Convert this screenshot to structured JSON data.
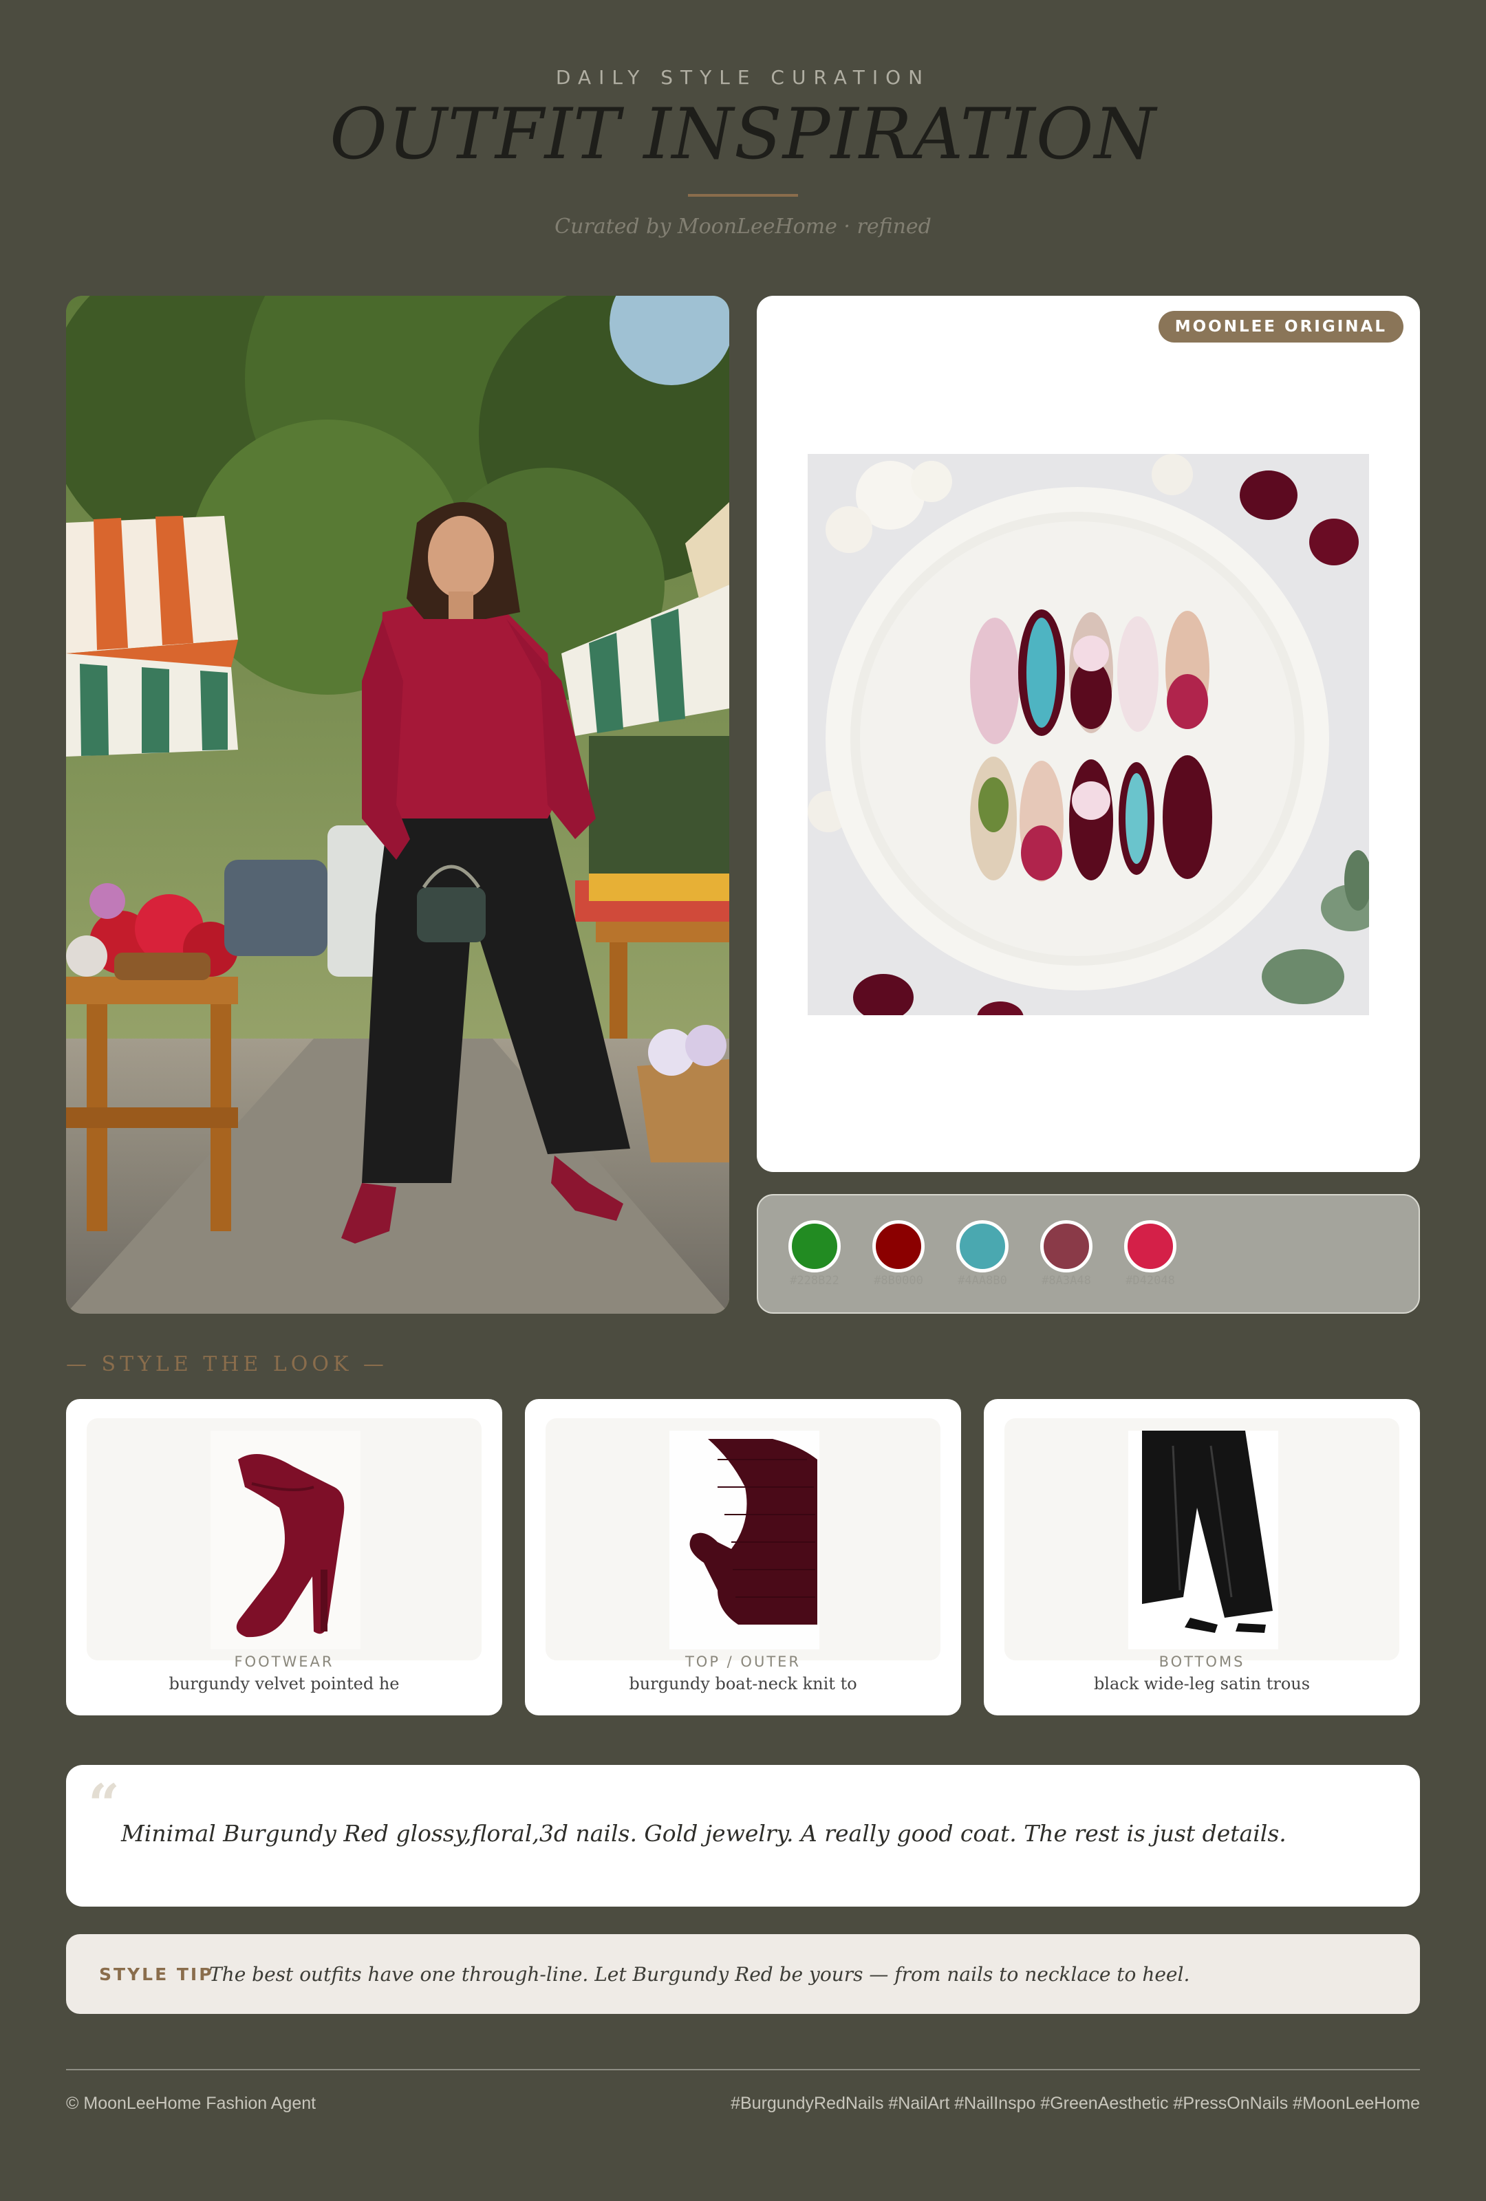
{
  "header": {
    "kicker": "DAILY STYLE CURATION",
    "title": "OUTFIT INSPIRATION",
    "subtitle": "Curated by MoonLeeHome · refined"
  },
  "nails_card": {
    "badge": "MOONLEE ORIGINAL"
  },
  "palette": {
    "swatches": [
      {
        "color": "#228B22",
        "hex": "#228B22"
      },
      {
        "color": "#8B0000",
        "hex": "#8B0000"
      },
      {
        "color": "#4AA8B0",
        "hex": "#4AA8B0"
      },
      {
        "color": "#8A3A48",
        "hex": "#8A3A48"
      },
      {
        "color": "#D42048",
        "hex": "#D42048"
      }
    ]
  },
  "look": {
    "section_label": "— STYLE THE LOOK —",
    "items": [
      {
        "category": "FOOTWEAR",
        "description": "burgundy velvet pointed he",
        "icon": "pump-shoe-icon"
      },
      {
        "category": "TOP / OUTER",
        "description": "burgundy boat-neck knit to",
        "icon": "knit-top-icon"
      },
      {
        "category": "BOTTOMS",
        "description": "black wide-leg satin trous",
        "icon": "trousers-icon"
      }
    ]
  },
  "quote": {
    "mark": "“",
    "text": "Minimal Burgundy Red glossy,floral,3d nails. Gold jewelry. A really good coat. The rest is just details."
  },
  "tip": {
    "label": "STYLE TIP",
    "text": "The best outfits have one through-line. Let Burgundy Red be yours — from nails to necklace to heel."
  },
  "footer": {
    "left": "© MoonLeeHome Fashion Agent",
    "right": "#BurgundyRedNails #NailArt #NailInspo #GreenAesthetic #PressOnNails #MoonLeeHome"
  },
  "colors": {
    "background": "#4c4c40",
    "accent": "#8a6d4c",
    "burgundy": "#8c1530"
  }
}
